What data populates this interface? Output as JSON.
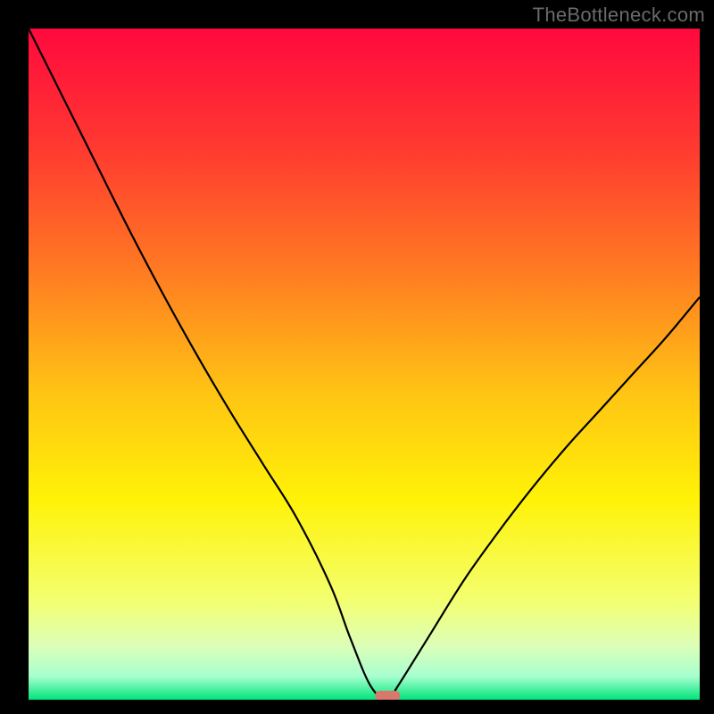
{
  "watermark": "TheBottleneck.com",
  "colors": {
    "accent_marker": "#d6796c",
    "curve_stroke": "#000000",
    "gradient_stops": [
      {
        "offset": 0.0,
        "color": "#ff093e"
      },
      {
        "offset": 0.18,
        "color": "#ff3a30"
      },
      {
        "offset": 0.36,
        "color": "#ff7a22"
      },
      {
        "offset": 0.54,
        "color": "#ffc314"
      },
      {
        "offset": 0.7,
        "color": "#fff207"
      },
      {
        "offset": 0.85,
        "color": "#f4ff6e"
      },
      {
        "offset": 0.92,
        "color": "#dcffb8"
      },
      {
        "offset": 0.965,
        "color": "#a8ffd0"
      },
      {
        "offset": 1.0,
        "color": "#00e47a"
      }
    ]
  },
  "chart_data": {
    "type": "line",
    "title": "",
    "xlabel": "",
    "ylabel": "",
    "xlim": [
      0,
      100
    ],
    "ylim": [
      0,
      100
    ],
    "x": [
      0,
      5,
      10,
      15,
      20,
      25,
      30,
      35,
      40,
      45,
      48,
      51,
      53.5,
      55,
      60,
      65,
      70,
      75,
      80,
      85,
      90,
      95,
      100
    ],
    "values": [
      100,
      90,
      80,
      70,
      60.5,
      51.5,
      43,
      35,
      27,
      17,
      9,
      2,
      0,
      2,
      10,
      18,
      25,
      31.5,
      37.5,
      43,
      48.5,
      54,
      60
    ],
    "minimum_marker": {
      "x": 53.5,
      "y": 0,
      "label": ""
    }
  }
}
